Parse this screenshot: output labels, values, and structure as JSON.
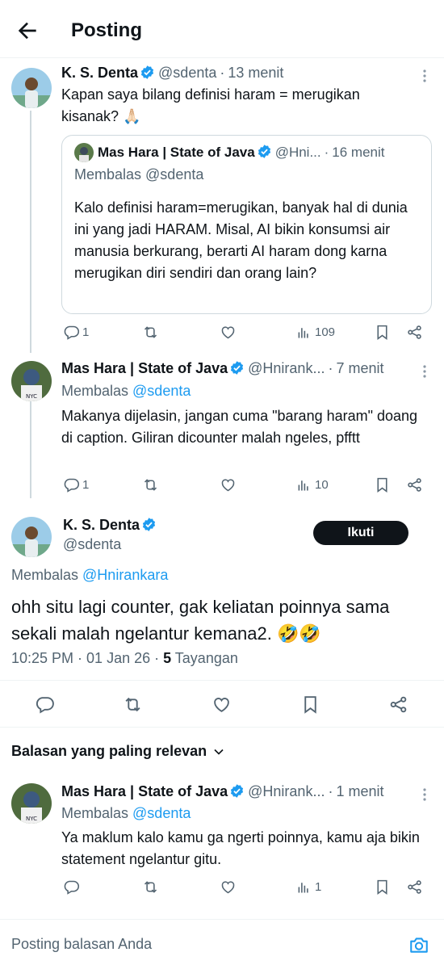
{
  "header": {
    "title": "Posting"
  },
  "tweet1": {
    "name": "K. S. Denta",
    "handle": "@sdenta",
    "sep": "·",
    "time": "13 menit",
    "text": "Kapan saya bilang definisi haram = merugikan kisanak? 🙏🏻",
    "quote": {
      "name": "Mas Hara | State of Java",
      "handle": "@Hni...",
      "sep": "·",
      "time": "16 menit",
      "replying": "Membalas @sdenta",
      "text": "Kalo definisi haram=merugikan, banyak hal di dunia ini yang jadi HARAM. Misal, AI bikin konsumsi air manusia berkurang, berarti AI haram dong karna merugikan diri sendiri dan orang lain?"
    },
    "actions": {
      "replies": "1",
      "views": "109"
    }
  },
  "tweet2": {
    "name": "Mas Hara | State of Java",
    "handle": "@Hnirank...",
    "sep": "·",
    "time": "7 menit",
    "replying_prefix": "Membalas ",
    "replying_handle": "@sdenta",
    "text": "Makanya dijelasin, jangan cuma \"barang haram\" doang di caption. Giliran dicounter malah ngeles, pfftt",
    "actions": {
      "replies": "1",
      "views": "10"
    }
  },
  "main": {
    "name": "K. S. Denta",
    "handle": "@sdenta",
    "follow_label": "Ikuti",
    "replying_prefix": "Membalas ",
    "replying_handle": "@Hnirankara",
    "text": "ohh situ lagi counter, gak keliatan poinnya sama sekali malah ngelantur kemana2. 🤣🤣",
    "time": "10:25 PM · 01 Jan 26 · ",
    "views_count": "5",
    "views_label": " Tayangan"
  },
  "sort": {
    "label": "Balasan yang paling relevan"
  },
  "tweet3": {
    "name": "Mas Hara | State of Java",
    "handle": "@Hnirank...",
    "sep": "·",
    "time": "1 menit",
    "replying_prefix": "Membalas ",
    "replying_handle": "@sdenta",
    "text": "Ya maklum kalo kamu ga ngerti poinnya, kamu aja bikin statement ngelantur gitu.",
    "actions": {
      "views": "1"
    }
  },
  "reply_bar": {
    "placeholder": "Posting balasan Anda"
  },
  "colors": {
    "accent": "#1d9bf0",
    "text": "#0f1419",
    "muted": "#536471",
    "border": "#cfd9de"
  },
  "icons": [
    "back-arrow-icon",
    "verified-icon",
    "more-icon",
    "reply-icon",
    "repost-icon",
    "like-icon",
    "views-icon",
    "bookmark-icon",
    "share-icon",
    "chevron-down-icon",
    "camera-icon"
  ]
}
